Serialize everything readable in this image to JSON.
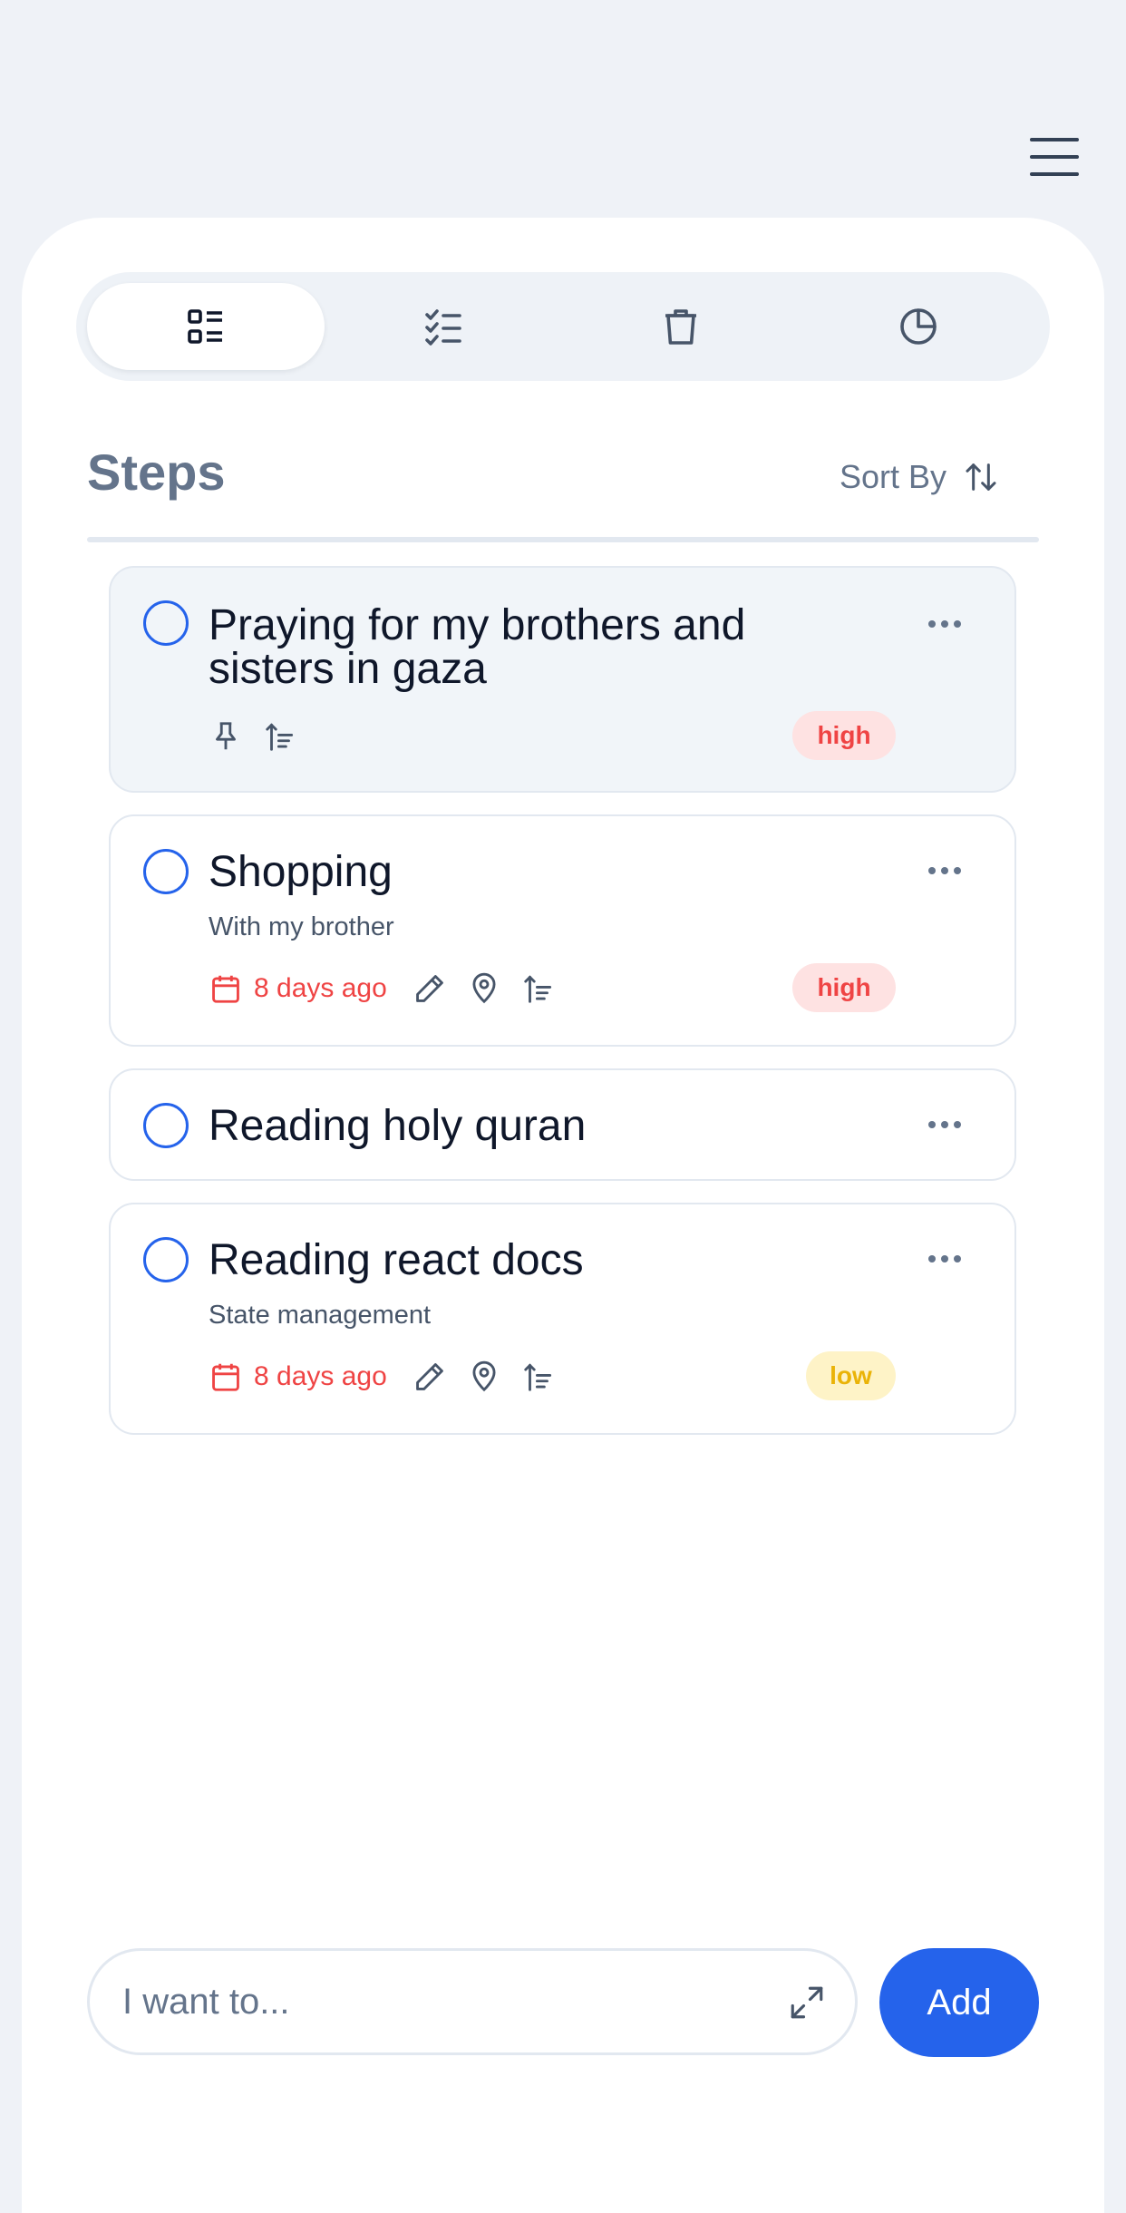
{
  "app": {
    "menu_icon": "hamburger-menu-icon"
  },
  "tabs": [
    {
      "name": "all-tasks",
      "icon": "list-icon",
      "active": true
    },
    {
      "name": "completed",
      "icon": "checklist-icon",
      "active": false
    },
    {
      "name": "trash",
      "icon": "trash-icon",
      "active": false
    },
    {
      "name": "stats",
      "icon": "pie-chart-icon",
      "active": false
    }
  ],
  "header": {
    "title": "Steps",
    "sort_label": "Sort By"
  },
  "tasks": [
    {
      "title": "Praying for my brothers and sisters in gaza",
      "description": "",
      "date": "",
      "priority": "high",
      "pinned": true
    },
    {
      "title": "Shopping",
      "description": "With my brother",
      "date": "8 days ago",
      "priority": "high"
    },
    {
      "title": "Reading holy quran",
      "description": "",
      "date": "",
      "priority": ""
    },
    {
      "title": "Reading react docs",
      "description": "State management",
      "date": "8 days ago",
      "priority": "low"
    }
  ],
  "composer": {
    "placeholder": "I want to...",
    "add_label": "Add"
  },
  "colors": {
    "accent": "#2563eb",
    "high": "#ef4444",
    "low": "#eab308",
    "muted": "#64748b"
  }
}
